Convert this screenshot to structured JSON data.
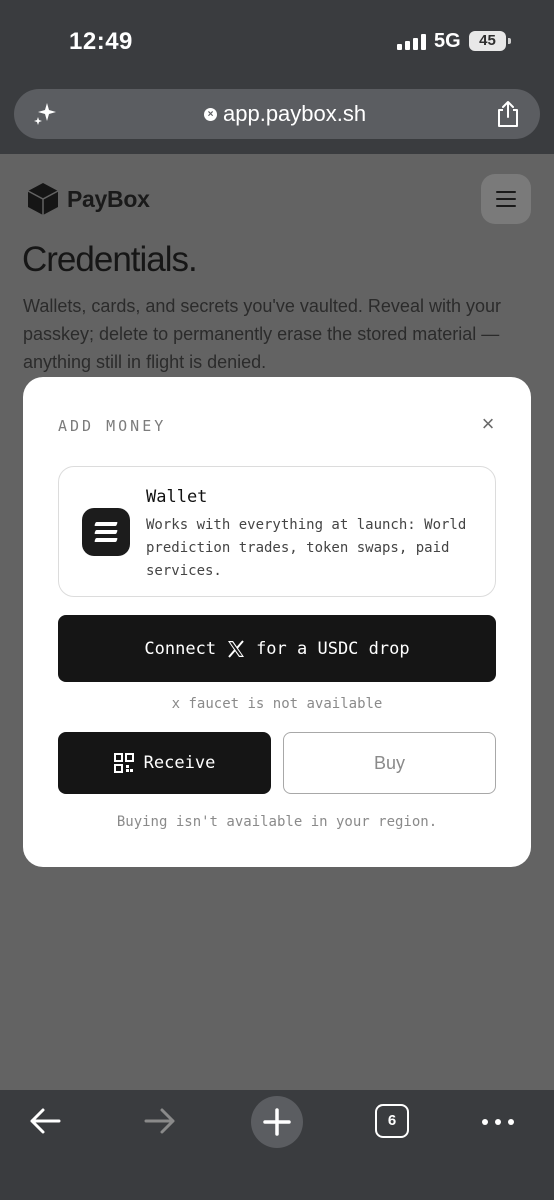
{
  "status_bar": {
    "time": "12:49",
    "network": "5G",
    "battery": "45"
  },
  "browser": {
    "url": "app.paybox.sh",
    "tab_count": "6"
  },
  "page": {
    "brand": "PayBox",
    "title": "Credentials.",
    "description": "Wallets, cards, and secrets you've vaulted. Reveal with your passkey; delete to permanently erase the stored material — anything still in flight is denied."
  },
  "modal": {
    "title": "ADD MONEY",
    "wallet": {
      "name": "Wallet",
      "description": "Works with everything at launch: World prediction trades, token swaps, paid services."
    },
    "connect_label_pre": "Connect",
    "connect_label_post": "for a USDC drop",
    "faucet_note": "x faucet is not available",
    "receive_label": "Receive",
    "buy_label": "Buy",
    "region_note": "Buying isn't available in your region."
  },
  "colors": {
    "modal_bg": "#ffffff",
    "primary_button": "#151515",
    "overlay_page": "#636363",
    "browser_chrome": "#3a3c3f"
  }
}
